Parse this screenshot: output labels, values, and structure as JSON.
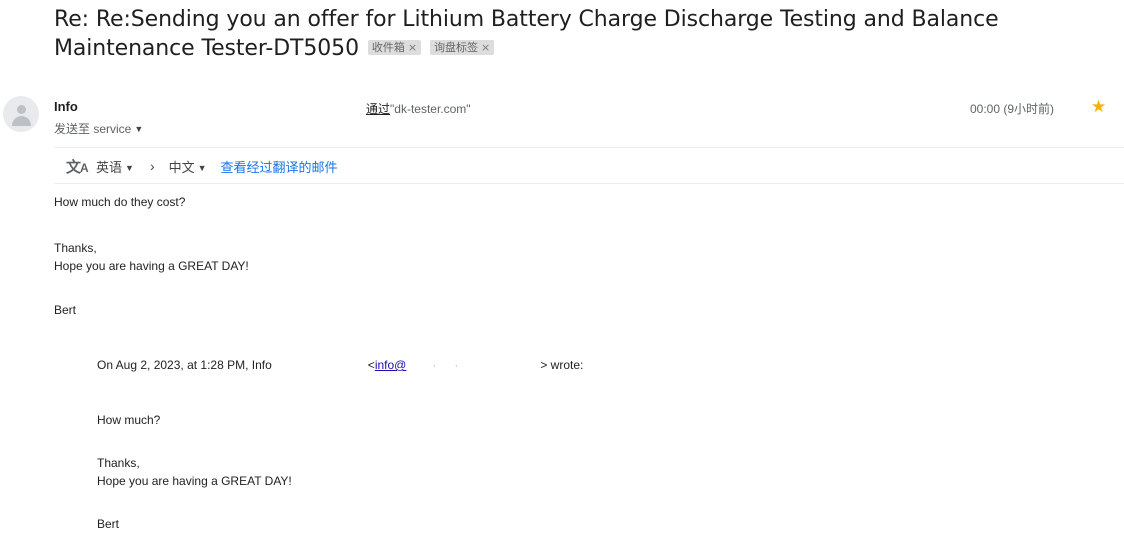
{
  "email": {
    "subject": "Re: Re:Sending you an offer for Lithium Battery Charge Discharge Testing and Balance Maintenance Tester-DT5050",
    "labels": [
      {
        "text": "收件箱",
        "close": "×"
      },
      {
        "text": "询盘标签",
        "close": "×"
      }
    ],
    "sender": {
      "name": "Info",
      "via_prefix": "通过",
      "via_domain": "\"dk-tester.com\"",
      "sent_to": "发送至 service",
      "time": "00:00 (9小时前)",
      "star": "★"
    },
    "translate": {
      "icon_main": "文",
      "icon_sub": "A",
      "from_lang": "英语",
      "arrow": "›",
      "to_lang": "中文",
      "view_translated": "查看经过翻译的邮件",
      "caret": "▼"
    },
    "body": {
      "line1": "How much do they cost?",
      "thanks": "Thanks,",
      "greeting": "Hope you are having a GREAT DAY!",
      "signature": "Bert"
    },
    "quoted": {
      "header_prefix": "On Aug 2, 2023, at 1:28 PM, Info",
      "email_open": "<",
      "email_link": "info@",
      "dot1": "·",
      "dot2": "·",
      "header_suffix": "> wrote:",
      "line1": "How much?",
      "thanks": "Thanks,",
      "greeting": "Hope you are having a GREAT DAY!",
      "signature": "Bert"
    }
  }
}
